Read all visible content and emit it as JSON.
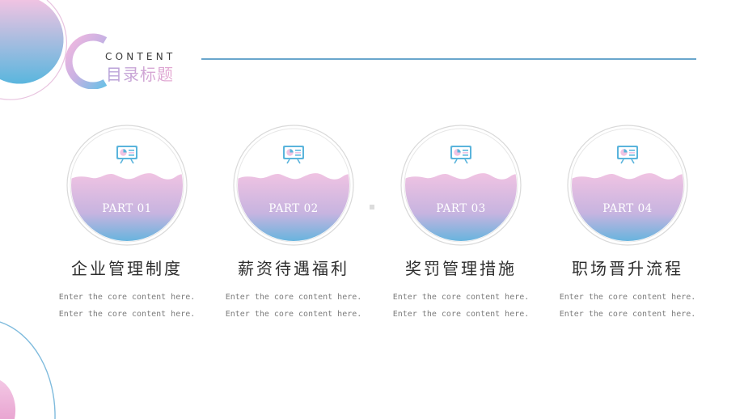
{
  "header": {
    "subtitle_en": "CONTENT",
    "title_zh": "目录标题"
  },
  "items": [
    {
      "part": "PART 01",
      "title": "企业管理制度",
      "desc1": "Enter the core content here.",
      "desc2": "Enter the core content here."
    },
    {
      "part": "PART 02",
      "title": "薪资待遇福利",
      "desc1": "Enter the core content here.",
      "desc2": "Enter the core content here."
    },
    {
      "part": "PART 03",
      "title": "奖罚管理措施",
      "desc1": "Enter the core content here.",
      "desc2": "Enter the core content here."
    },
    {
      "part": "PART 04",
      "title": "职场晋升流程",
      "desc1": "Enter the core content here.",
      "desc2": "Enter the core content here."
    }
  ],
  "colors": {
    "pink": "#eec2e0",
    "blue": "#5ab4dc",
    "accent_line": "#6aa6cc"
  },
  "icons": [
    "presentation-board-icon"
  ]
}
